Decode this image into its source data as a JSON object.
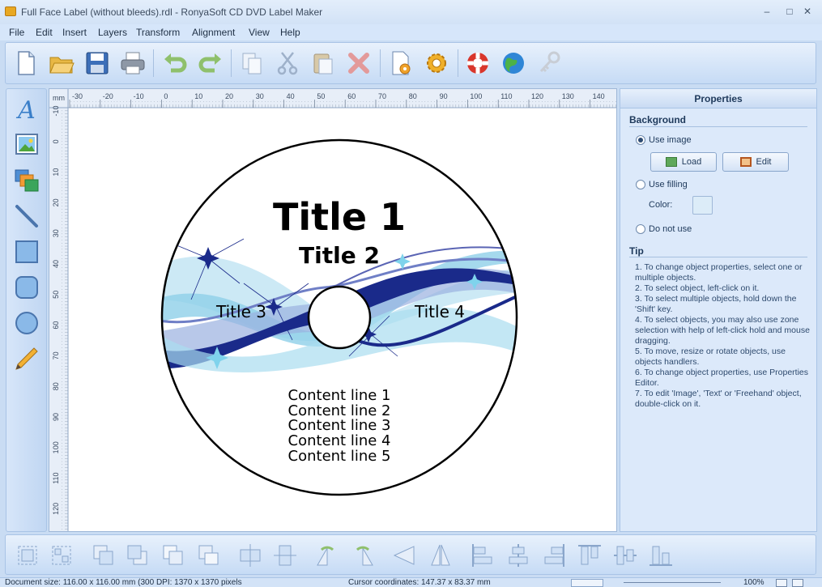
{
  "window": {
    "title": "Full Face Label (without bleeds).rdl - RonyaSoft CD DVD Label Maker",
    "minimize": "–",
    "maximize": "□",
    "close": "✕"
  },
  "menu": [
    "File",
    "Edit",
    "Insert",
    "Layers",
    "Transform",
    "Alignment",
    "View",
    "Help"
  ],
  "toolbar": {
    "icons": [
      "new-document-icon",
      "open-folder-icon",
      "save-icon",
      "print-icon",
      "undo-icon",
      "redo-icon",
      "copy-icon",
      "cut-icon",
      "paste-icon",
      "delete-icon",
      "page-settings-icon",
      "options-gear-icon",
      "help-lifebuoy-icon",
      "website-globe-icon",
      "register-key-icon"
    ]
  },
  "left_tools": [
    "text-tool-icon",
    "image-tool-icon",
    "clipart-tool-icon",
    "line-tool-icon",
    "rectangle-tool-icon",
    "rounded-rectangle-tool-icon",
    "ellipse-tool-icon",
    "freehand-pencil-icon"
  ],
  "ruler": {
    "unit": "mm",
    "h_ticks": [
      "-30",
      "-20",
      "-10",
      "0",
      "10",
      "20",
      "30",
      "40",
      "50",
      "60",
      "70",
      "80",
      "90",
      "100",
      "110",
      "120",
      "130",
      "140"
    ],
    "v_ticks": [
      "-10",
      "0",
      "10",
      "20",
      "30",
      "40",
      "50",
      "60",
      "70",
      "80",
      "90",
      "100",
      "110",
      "120"
    ]
  },
  "label": {
    "title1": "Title 1",
    "title2": "Title 2",
    "title3": "Title 3",
    "title4": "Title 4",
    "content_lines": [
      "Content line 1",
      "Content line 2",
      "Content line 3",
      "Content line 4",
      "Content line 5"
    ]
  },
  "properties": {
    "header": "Properties",
    "background_section": "Background",
    "use_image": "Use image",
    "use_image_checked": true,
    "load_button": "Load",
    "edit_button": "Edit",
    "use_filling": "Use filling",
    "color_label": "Color:",
    "color_value": "#dcecf8",
    "do_not_use": "Do not use",
    "tip_section": "Tip",
    "tip_lines": [
      "1. To change object properties, select one or multiple objects.",
      "2. To select object, left-click on it.",
      "3. To select multiple objects, hold down the 'Shift' key.",
      "4. To select objects, you may also use zone selection with help of left-click hold and mouse dragging.",
      "5. To move, resize or rotate objects, use objects handlers.",
      "6. To change object properties, use Properties Editor.",
      "7. To edit 'Image', 'Text' or 'Freehand' object, double-click on it."
    ]
  },
  "bottom_toolbar": {
    "icons": [
      "group-icon",
      "ungroup-icon",
      "bring-to-front-icon",
      "send-to-back-icon",
      "bring-forward-icon",
      "send-backward-icon",
      "center-horizontally-icon",
      "center-vertically-icon",
      "rotate-left-icon",
      "rotate-right-icon",
      "flip-horizontal-icon",
      "flip-vertical-icon",
      "align-left-icon",
      "align-center-icon",
      "align-right-icon",
      "align-top-icon",
      "align-middle-icon",
      "align-bottom-icon"
    ]
  },
  "status": {
    "doc_size": "Document size: 116.00 x 116.00 mm (300 DPI: 1370 x 1370 pixels",
    "cursor": "Cursor coordinates: 147.37 x 83.37 mm",
    "zoom": "100%"
  },
  "colors": {
    "accent": "#1a2a8a",
    "wave_light": "#8fd0e8",
    "panel": "#dce9fa"
  }
}
